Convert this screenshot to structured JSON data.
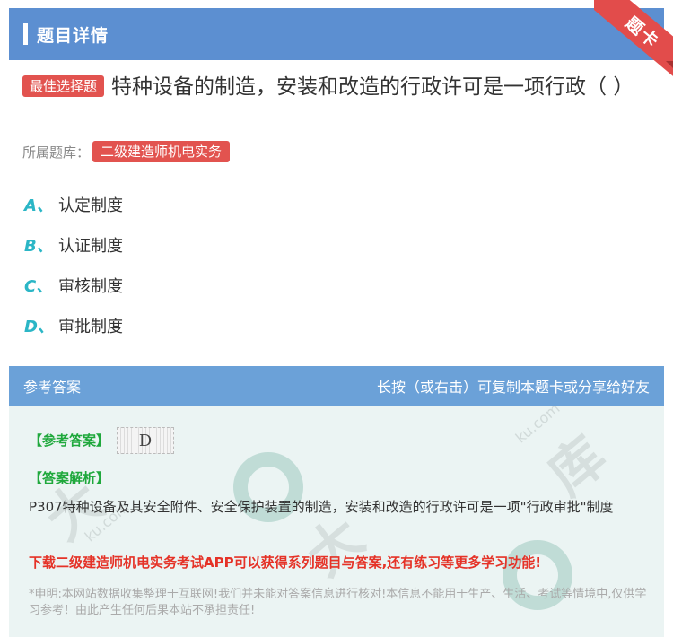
{
  "header": {
    "title": "题目详情",
    "ribbon": "题卡"
  },
  "question": {
    "tag": "最佳选择题",
    "text": "特种设备的制造，安装和改造的行政许可是一项行政（ ）",
    "bank_label": "所属题库：",
    "bank": "二级建造师机电实务"
  },
  "options": [
    {
      "letter": "A、",
      "text": "认定制度"
    },
    {
      "letter": "B、",
      "text": "认证制度"
    },
    {
      "letter": "C、",
      "text": "审核制度"
    },
    {
      "letter": "D、",
      "text": "审批制度"
    }
  ],
  "answer": {
    "header_left": "参考答案",
    "header_right": "长按（或右击）可复制本题卡或分享给好友",
    "ref_label": "【参考答案】",
    "ref_value": "D",
    "analysis_label": "【答案解析】",
    "analysis": "P307特种设备及其安全附件、安全保护装置的制造，安装和改造的行政许可是一项\"行政审批\"制度",
    "download": "下载二级建造师机电实务考试APP可以获得系列题目与答案,还有练习等更多学习功能!",
    "disclaimer": "*申明:本网站数据收集整理于互联网!我们并未能对答案信息进行核对!本信息不能用于生产、生活、考试等情境中,仅供学习参考！由此产生任何后果本站不承担责任!"
  },
  "colors": {
    "header": "#5c8fd1",
    "tag": "#e2534f",
    "option_letter": "#2bb6c6",
    "green": "#1fa83c",
    "red": "#e53227"
  }
}
